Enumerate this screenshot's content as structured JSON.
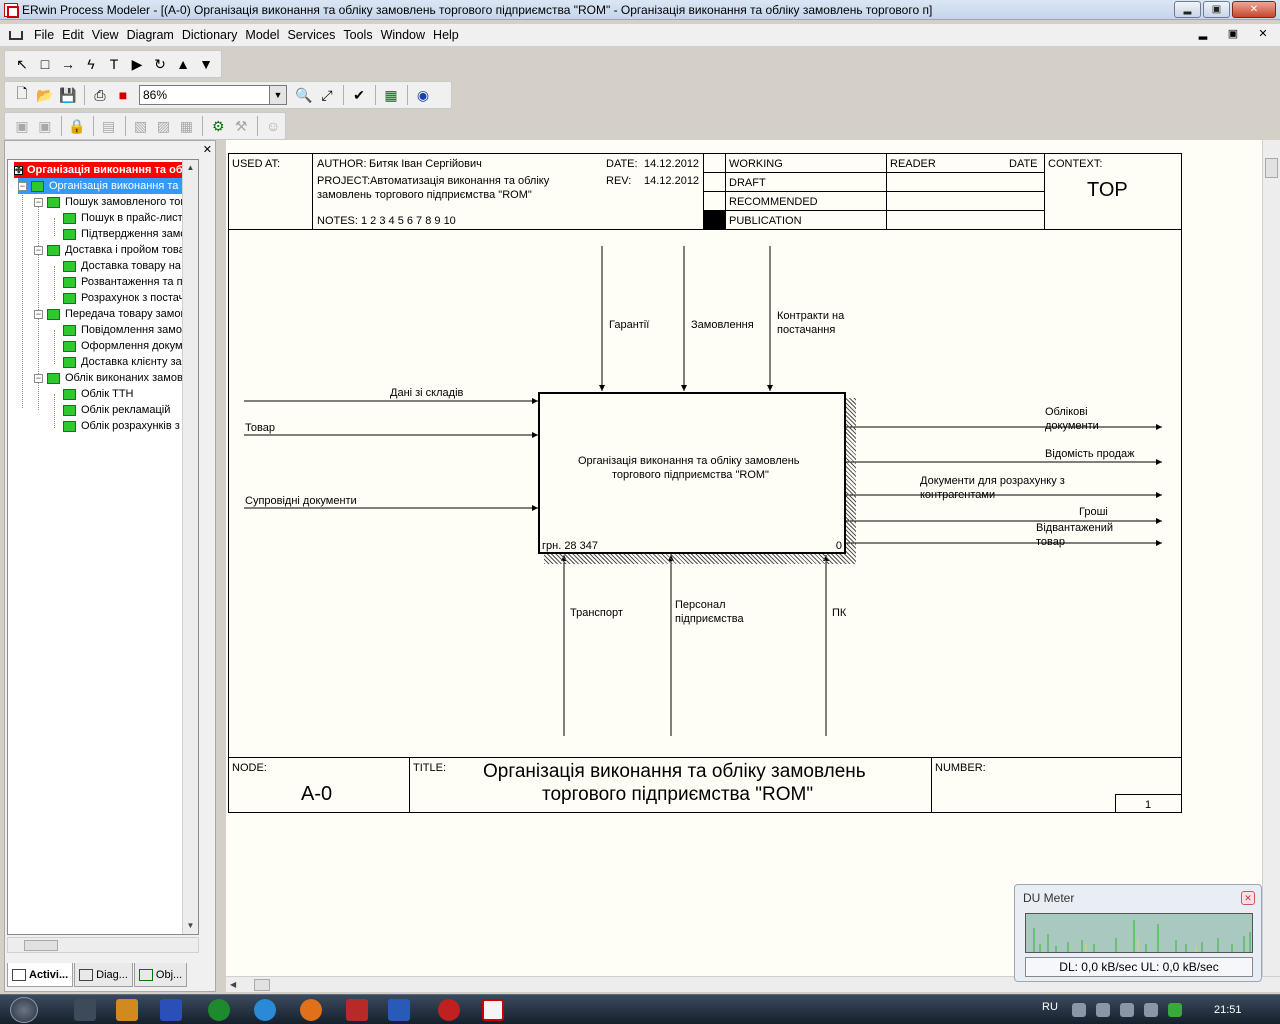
{
  "window": {
    "title": "ERwin Process Modeler - [(A-0) Організація виконання та обліку замовлень  торгового підприємства \"ROM\" - Організація виконання та обліку замовлень торгового п]",
    "buttons": {
      "minimize": "▂",
      "restore": "▣",
      "close": "✕"
    }
  },
  "menu": [
    "File",
    "Edit",
    "View",
    "Diagram",
    "Dictionary",
    "Model",
    "Services",
    "Tools",
    "Window",
    "Help"
  ],
  "toolbar": {
    "zoom": "86%"
  },
  "tree": {
    "root": "Організація виконання та облі",
    "selected": "Організація виконання та об",
    "groups": [
      {
        "label": "Пошук  замовленого тов",
        "children": [
          "Пошук в прайс-листа:",
          "Підтвердження замов"
        ]
      },
      {
        "label": "Доставка і  пройом товар",
        "children": [
          "Доставка товару на  г",
          "Розвантаження та пер",
          "Розрахунок з постача"
        ]
      },
      {
        "label": "Передача товару  замов",
        "children": [
          "Повідомлення замовн",
          "Оформлення докумен",
          "Доставка клієнту за а"
        ]
      },
      {
        "label": "Облік виконаних замовл",
        "children": [
          "Облік ТТН",
          "Облік рекламацій",
          "Облік розрахунків  з"
        ]
      }
    ],
    "tabs": [
      "Activi...",
      "Diag...",
      "Obj..."
    ]
  },
  "diagram": {
    "header": {
      "used_at_label": "USED AT:",
      "author_label": "AUTHOR:",
      "author": "Битяк Іван Сергійович",
      "project_label": "PROJECT:",
      "project": "Автоматизація виконання та обліку",
      "project2": "замовлень торгового підприємства \"ROM\"",
      "notes_label": "NOTES:",
      "notes": "1  2  3  4  5  6  7  8  9  10",
      "date_label": "DATE:",
      "date": "14.12.2012",
      "rev_label": "REV:",
      "rev": "14.12.2012",
      "status": [
        "WORKING",
        "DRAFT",
        "RECOMMENDED",
        "PUBLICATION"
      ],
      "reader_label": "READER",
      "date2_label": "DATE",
      "context_label": "CONTEXT:",
      "context": "TOP"
    },
    "activity": {
      "name_line1": "Організація виконання та обліку замовлень",
      "name_line2": "торгового підприємства \"ROM\"",
      "cost": "грн. 28 347",
      "number": "0"
    },
    "controls": [
      "Гарантії",
      "Замовлення",
      "Контракти на",
      "постачання"
    ],
    "inputs": [
      "Дані зі складів",
      "Товар",
      "Супровідні документи"
    ],
    "outputs": [
      "Облікові",
      "документи",
      "Відомість продаж",
      "Документи для розрахунку з",
      "контрагентами",
      "Гроші",
      "Відвантажений",
      "товар"
    ],
    "mechanisms": [
      "Транспорт",
      "Персонал",
      "підприємства",
      "ПК"
    ],
    "footer": {
      "node_label": "NODE:",
      "node": "A-0",
      "title_label": "TITLE:",
      "title1": "Організація виконання та обліку замовлень",
      "title2": "торгового підприємства \"ROM\"",
      "number_label": "NUMBER:",
      "page": "1"
    }
  },
  "dumeter": {
    "title": "DU Meter",
    "stats": "DL: 0,0 kB/sec  UL: 0,0 kB/sec"
  },
  "taskbar": {
    "lang": "RU",
    "time": "21:51"
  }
}
